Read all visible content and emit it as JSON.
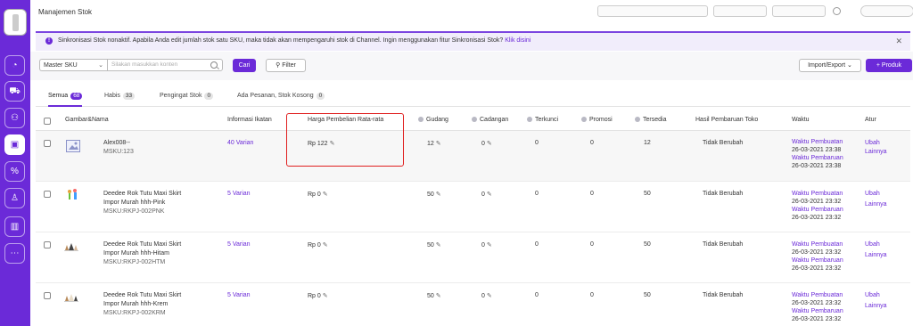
{
  "page_title": "Manajemen Stok",
  "banner": {
    "text": "Sinkronisasi Stok nonaktif. Apabila Anda edit jumlah stok satu SKU, maka tidak akan mempengaruhi stok di Channel. Ingin menggunakan fitur Sinkronisasi Stok?",
    "link": "Klik disini"
  },
  "search": {
    "select_value": "Master SKU",
    "placeholder": "Silakan masukkan konten",
    "search_button": "Cari",
    "filter_button": "Filter",
    "import_button": "Import/Export",
    "add_button": "+ Produk"
  },
  "tabs": [
    {
      "label": "Semua",
      "count": "68"
    },
    {
      "label": "Habis",
      "count": "33"
    },
    {
      "label": "Pengingat Stok",
      "count": "0"
    },
    {
      "label": "Ada Pesanan, Stok Kosong",
      "count": "0"
    }
  ],
  "headers": {
    "gambar_nama": "Gambar&Nama",
    "info_ikatan": "Informasi Ikatan",
    "harga": "Harga Pembelian Rata-rata",
    "gudang": "Gudang",
    "cadangan": "Cadangan",
    "terkunci": "Terkunci",
    "promosi": "Promosi",
    "tersedia": "Tersedia",
    "hasil": "Hasil Pembaruan Toko",
    "waktu": "Waktu",
    "atur": "Atur"
  },
  "labels": {
    "waktu_pembuatan": "Waktu Pembuatan",
    "waktu_pembaruan": "Waktu Pembaruan",
    "ubah": "Ubah",
    "lainnya": "Lainnya"
  },
  "rows": [
    {
      "name1": "Alex008--",
      "name2": "",
      "msku": "MSKU:123",
      "ikatan": "40 Varian",
      "harga": "Rp 122",
      "gudang": "12",
      "cadangan": "0",
      "terkunci": "0",
      "promosi": "0",
      "tersedia": "12",
      "hasil": "Tidak Berubah",
      "created": "26-03-2021 23:38",
      "updated": "26-03-2021 23:38"
    },
    {
      "name1": "Deedee Rok Tutu Maxi Skirt",
      "name2": "Impor Murah hhh-Pink",
      "msku": "MSKU:RKPJ-002PNK",
      "ikatan": "5 Varian",
      "harga": "Rp 0",
      "gudang": "50",
      "cadangan": "0",
      "terkunci": "0",
      "promosi": "0",
      "tersedia": "50",
      "hasil": "Tidak Berubah",
      "created": "26-03-2021 23:32",
      "updated": "26-03-2021 23:32"
    },
    {
      "name1": "Deedee Rok Tutu Maxi Skirt",
      "name2": "Impor Murah hhh-Hitam",
      "msku": "MSKU:RKPJ-002HTM",
      "ikatan": "5 Varian",
      "harga": "Rp 0",
      "gudang": "50",
      "cadangan": "0",
      "terkunci": "0",
      "promosi": "0",
      "tersedia": "50",
      "hasil": "Tidak Berubah",
      "created": "26-03-2021 23:32",
      "updated": "26-03-2021 23:32"
    },
    {
      "name1": "Deedee Rok Tutu Maxi Skirt",
      "name2": "Impor Murah hhh-Krem",
      "msku": "MSKU:RKPJ-002KRM",
      "ikatan": "5 Varian",
      "harga": "Rp 0",
      "gudang": "50",
      "cadangan": "0",
      "terkunci": "0",
      "promosi": "0",
      "tersedia": "50",
      "hasil": "Tidak Berubah",
      "created": "26-03-2021 23:32",
      "updated": "26-03-2021 23:32"
    }
  ],
  "sidebar_icons": [
    "dashboard-icon",
    "cart-icon",
    "network-icon",
    "box-icon",
    "percent-icon",
    "user-icon",
    "chart-icon",
    "chat-icon"
  ],
  "colors": {
    "accent": "#6b2ad8",
    "highlight": "#e02020"
  }
}
